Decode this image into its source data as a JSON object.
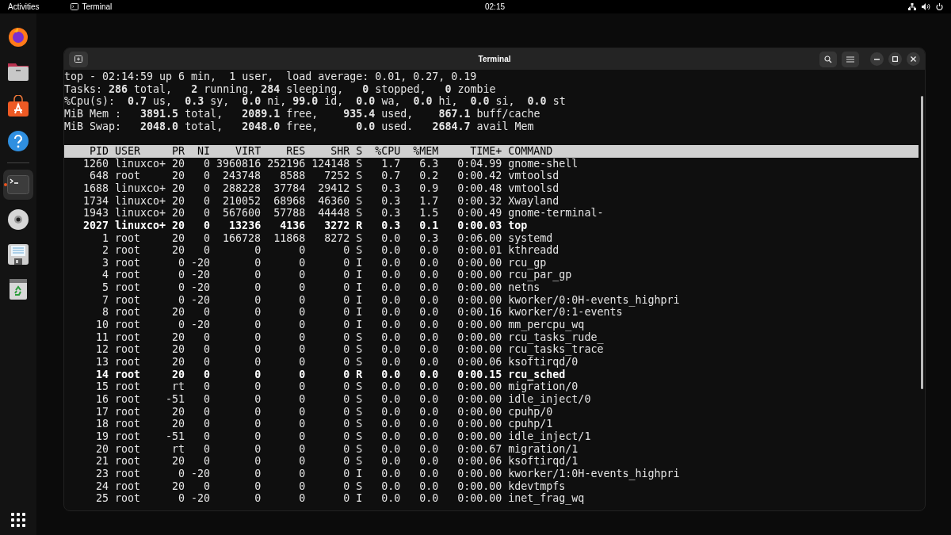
{
  "top_bar": {
    "activities": "Activities",
    "app_name": "Terminal",
    "clock": "02:15"
  },
  "dock": {
    "items": [
      {
        "kind": "browser",
        "running": false
      },
      {
        "kind": "files",
        "running": false
      },
      {
        "kind": "software",
        "running": false
      },
      {
        "kind": "help",
        "running": false
      },
      {
        "kind": "terminal",
        "running": true
      },
      {
        "kind": "disc",
        "running": false
      },
      {
        "kind": "floppy",
        "running": false
      },
      {
        "kind": "trash",
        "running": false
      }
    ]
  },
  "window": {
    "title": "Terminal"
  },
  "terminal": {
    "summary": [
      "top - 02:14:59 up 6 min,  1 user,  load average: 0.01, 0.27, 0.19",
      "Tasks: **286** total,   **2** running, **284** sleeping,   **0** stopped,   **0** zombie",
      "%Cpu(s):  **0.7** us,  **0.3** sy,  **0.0** ni, **99.0** id,  **0.0** wa,  **0.0** hi,  **0.0** si,  **0.0** st",
      "MiB Mem :   **3891.5** total,   **2089.1** free,    **935.4** used,    **867.1** buff/cache",
      "MiB Swap:   **2048.0** total,   **2048.0** free,      **0.0** used.   **2684.7** avail Mem"
    ],
    "columns": [
      "PID",
      "USER",
      "PR",
      "NI",
      "VIRT",
      "RES",
      "SHR",
      "S",
      "%CPU",
      "%MEM",
      "TIME+",
      "COMMAND"
    ],
    "rows": [
      {
        "bold": false,
        "cells": [
          "1260",
          "linuxco+",
          "20",
          "0",
          "3960816",
          "252196",
          "124148",
          "S",
          "1.7",
          "6.3",
          "0:04.99",
          "gnome-shell"
        ]
      },
      {
        "bold": false,
        "cells": [
          "648",
          "root",
          "20",
          "0",
          "243748",
          "8588",
          "7252",
          "S",
          "0.7",
          "0.2",
          "0:00.42",
          "vmtoolsd"
        ]
      },
      {
        "bold": false,
        "cells": [
          "1688",
          "linuxco+",
          "20",
          "0",
          "288228",
          "37784",
          "29412",
          "S",
          "0.3",
          "0.9",
          "0:00.48",
          "vmtoolsd"
        ]
      },
      {
        "bold": false,
        "cells": [
          "1734",
          "linuxco+",
          "20",
          "0",
          "210052",
          "68968",
          "46360",
          "S",
          "0.3",
          "1.7",
          "0:00.32",
          "Xwayland"
        ]
      },
      {
        "bold": false,
        "cells": [
          "1943",
          "linuxco+",
          "20",
          "0",
          "567600",
          "57788",
          "44448",
          "S",
          "0.3",
          "1.5",
          "0:00.49",
          "gnome-terminal-"
        ]
      },
      {
        "bold": true,
        "cells": [
          "2027",
          "linuxco+",
          "20",
          "0",
          "13236",
          "4136",
          "3272",
          "R",
          "0.3",
          "0.1",
          "0:00.03",
          "top"
        ]
      },
      {
        "bold": false,
        "cells": [
          "1",
          "root",
          "20",
          "0",
          "166728",
          "11868",
          "8272",
          "S",
          "0.0",
          "0.3",
          "0:06.00",
          "systemd"
        ]
      },
      {
        "bold": false,
        "cells": [
          "2",
          "root",
          "20",
          "0",
          "0",
          "0",
          "0",
          "S",
          "0.0",
          "0.0",
          "0:00.01",
          "kthreadd"
        ]
      },
      {
        "bold": false,
        "cells": [
          "3",
          "root",
          "0",
          "-20",
          "0",
          "0",
          "0",
          "I",
          "0.0",
          "0.0",
          "0:00.00",
          "rcu_gp"
        ]
      },
      {
        "bold": false,
        "cells": [
          "4",
          "root",
          "0",
          "-20",
          "0",
          "0",
          "0",
          "I",
          "0.0",
          "0.0",
          "0:00.00",
          "rcu_par_gp"
        ]
      },
      {
        "bold": false,
        "cells": [
          "5",
          "root",
          "0",
          "-20",
          "0",
          "0",
          "0",
          "I",
          "0.0",
          "0.0",
          "0:00.00",
          "netns"
        ]
      },
      {
        "bold": false,
        "cells": [
          "7",
          "root",
          "0",
          "-20",
          "0",
          "0",
          "0",
          "I",
          "0.0",
          "0.0",
          "0:00.00",
          "kworker/0:0H-events_highpri"
        ]
      },
      {
        "bold": false,
        "cells": [
          "8",
          "root",
          "20",
          "0",
          "0",
          "0",
          "0",
          "I",
          "0.0",
          "0.0",
          "0:00.16",
          "kworker/0:1-events"
        ]
      },
      {
        "bold": false,
        "cells": [
          "10",
          "root",
          "0",
          "-20",
          "0",
          "0",
          "0",
          "I",
          "0.0",
          "0.0",
          "0:00.00",
          "mm_percpu_wq"
        ]
      },
      {
        "bold": false,
        "cells": [
          "11",
          "root",
          "20",
          "0",
          "0",
          "0",
          "0",
          "S",
          "0.0",
          "0.0",
          "0:00.00",
          "rcu_tasks_rude_"
        ]
      },
      {
        "bold": false,
        "cells": [
          "12",
          "root",
          "20",
          "0",
          "0",
          "0",
          "0",
          "S",
          "0.0",
          "0.0",
          "0:00.00",
          "rcu_tasks_trace"
        ]
      },
      {
        "bold": false,
        "cells": [
          "13",
          "root",
          "20",
          "0",
          "0",
          "0",
          "0",
          "S",
          "0.0",
          "0.0",
          "0:00.06",
          "ksoftirqd/0"
        ]
      },
      {
        "bold": true,
        "cells": [
          "14",
          "root",
          "20",
          "0",
          "0",
          "0",
          "0",
          "R",
          "0.0",
          "0.0",
          "0:00.15",
          "rcu_sched"
        ]
      },
      {
        "bold": false,
        "cells": [
          "15",
          "root",
          "rt",
          "0",
          "0",
          "0",
          "0",
          "S",
          "0.0",
          "0.0",
          "0:00.00",
          "migration/0"
        ]
      },
      {
        "bold": false,
        "cells": [
          "16",
          "root",
          "-51",
          "0",
          "0",
          "0",
          "0",
          "S",
          "0.0",
          "0.0",
          "0:00.00",
          "idle_inject/0"
        ]
      },
      {
        "bold": false,
        "cells": [
          "17",
          "root",
          "20",
          "0",
          "0",
          "0",
          "0",
          "S",
          "0.0",
          "0.0",
          "0:00.00",
          "cpuhp/0"
        ]
      },
      {
        "bold": false,
        "cells": [
          "18",
          "root",
          "20",
          "0",
          "0",
          "0",
          "0",
          "S",
          "0.0",
          "0.0",
          "0:00.00",
          "cpuhp/1"
        ]
      },
      {
        "bold": false,
        "cells": [
          "19",
          "root",
          "-51",
          "0",
          "0",
          "0",
          "0",
          "S",
          "0.0",
          "0.0",
          "0:00.00",
          "idle_inject/1"
        ]
      },
      {
        "bold": false,
        "cells": [
          "20",
          "root",
          "rt",
          "0",
          "0",
          "0",
          "0",
          "S",
          "0.0",
          "0.0",
          "0:00.67",
          "migration/1"
        ]
      },
      {
        "bold": false,
        "cells": [
          "21",
          "root",
          "20",
          "0",
          "0",
          "0",
          "0",
          "S",
          "0.0",
          "0.0",
          "0:00.06",
          "ksoftirqd/1"
        ]
      },
      {
        "bold": false,
        "cells": [
          "23",
          "root",
          "0",
          "-20",
          "0",
          "0",
          "0",
          "I",
          "0.0",
          "0.0",
          "0:00.00",
          "kworker/1:0H-events_highpri"
        ]
      },
      {
        "bold": false,
        "cells": [
          "24",
          "root",
          "20",
          "0",
          "0",
          "0",
          "0",
          "S",
          "0.0",
          "0.0",
          "0:00.00",
          "kdevtmpfs"
        ]
      },
      {
        "bold": false,
        "cells": [
          "25",
          "root",
          "0",
          "-20",
          "0",
          "0",
          "0",
          "I",
          "0.0",
          "0.0",
          "0:00.00",
          "inet_frag_wq"
        ]
      }
    ]
  }
}
